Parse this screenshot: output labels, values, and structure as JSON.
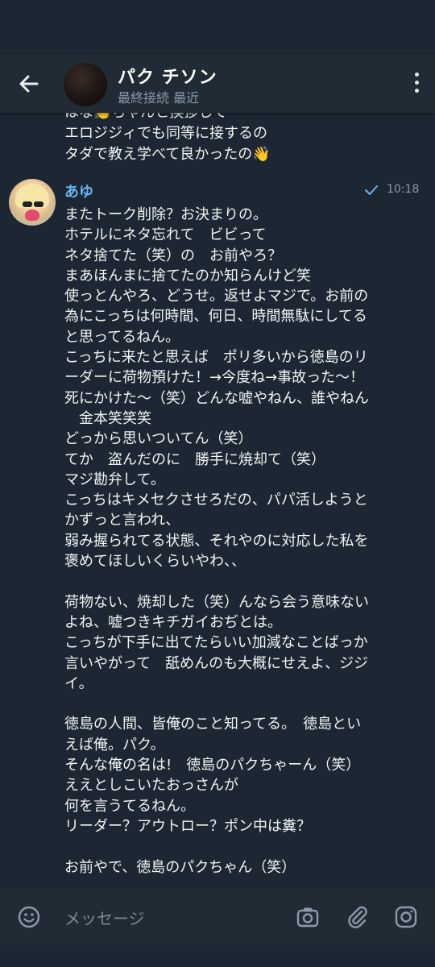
{
  "header": {
    "title": "パク チソン",
    "subtitle": "最終接続 最近"
  },
  "previous_message": {
    "lines": [
      "はな👏ちゃんと挨拶して",
      "エロジジィでも同等に接するの",
      "タダで教え学べて良かったの👋"
    ]
  },
  "message": {
    "sender": "あゆ",
    "time": "10:18",
    "status": "read-check",
    "lines": [
      "またトーク削除？お決まりの。",
      "ホテルにネタ忘れて　ビビって",
      "ネタ捨てた（笑）の　お前やろ？",
      "まあほんまに捨てたのか知らんけど笑",
      "使っとんやろ、どうせ。返せよマジで。お前の",
      "為にこっちは何時間、何日、時間無駄にしてる",
      "と思ってるねん。",
      "こっちに来たと思えば　ポリ多いから徳島のリ",
      "ーダーに荷物預けた！→今度ね→事故った〜！",
      "死にかけた〜（笑）どんな嘘やねん、誰やねん",
      "　金本笑笑笑",
      "どっから思いついてん（笑）",
      "てか　盗んだのに　勝手に焼却て（笑）",
      "マジ勘弁して。",
      "こっちはキメセクさせろだの、パパ活しようと",
      "かずっと言われ、",
      "弱み握られてる状態、それやのに対応した私を",
      "褒めてほしいくらいやわ、、",
      "",
      "荷物ない、焼却した（笑）んなら会う意味ない",
      "よね、嘘つきキチガイおぢとは。",
      "こっちが下手に出てたらいい加減なことばっか",
      "言いやがって　舐めんのも大概にせえよ、ジジ",
      "イ。",
      "",
      "徳島の人間、皆俺のこと知ってる。　徳島とい",
      "えば俺。パク。",
      "そんな俺の名は!　徳島のパクちゃーん（笑）",
      "ええとしこいたおっさんが",
      "何を言うてるねん。",
      "リーダー？アウトロー？ポン中は糞？",
      "",
      "お前やで、徳島のパクちゃん（笑）"
    ]
  },
  "composer": {
    "placeholder": "メッセージ"
  },
  "icons": {
    "back": "arrow-left-icon",
    "menu": "more-vert-icon",
    "emoji": "emoji-icon",
    "camera": "camera-icon",
    "attach": "paperclip-icon",
    "sticker": "instagram-camera-icon"
  },
  "colors": {
    "background": "#1c2733",
    "header": "#202b36",
    "sender_name": "#6ab3f3",
    "text": "#f2f4f6",
    "muted": "#8b9aa8"
  }
}
